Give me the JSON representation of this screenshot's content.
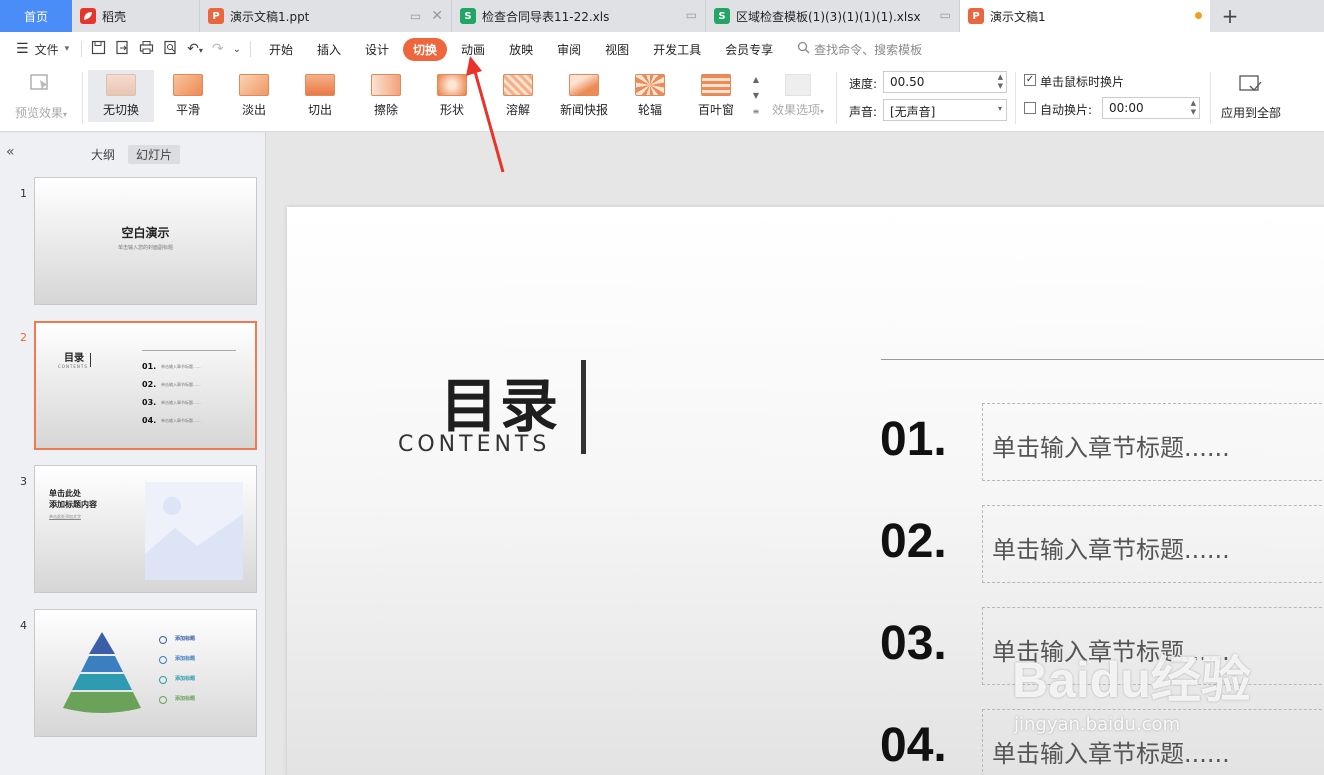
{
  "tabs": [
    {
      "label": "首页"
    },
    {
      "label": "稻壳"
    },
    {
      "label": "演示文稿1.ppt"
    },
    {
      "label": "检查合同导表11-22.xls"
    },
    {
      "label": "区域检查模板(1)(3)(1)(1)(1).xlsx"
    },
    {
      "label": "演示文稿1"
    }
  ],
  "tab_plus": "+",
  "menu": {
    "file": "文件",
    "tabs": [
      "开始",
      "插入",
      "设计",
      "切换",
      "动画",
      "放映",
      "审阅",
      "视图",
      "开发工具",
      "会员专享"
    ],
    "active_tab": "切换",
    "search_placeholder": "查找命令、搜索模板"
  },
  "ribbon": {
    "preview": "预览效果",
    "effects": [
      "无切换",
      "平滑",
      "淡出",
      "切出",
      "擦除",
      "形状",
      "溶解",
      "新闻快报",
      "轮辐",
      "百叶窗"
    ],
    "selected_effect": "无切换",
    "effect_options": "效果选项",
    "speed_label": "速度:",
    "speed_value": "00.50",
    "sound_label": "声音:",
    "sound_value": "[无声音]",
    "click_switch": "单击鼠标时换片",
    "click_switch_checked": true,
    "auto_switch": "自动换片:",
    "auto_switch_checked": false,
    "auto_switch_value": "00:00",
    "apply_all": "应用到全部"
  },
  "left_panel": {
    "collapse": "«",
    "tabs": [
      "大纲",
      "幻灯片"
    ],
    "active_tab": "幻灯片",
    "slides": [
      {
        "num": "1",
        "title": "空白演示",
        "subtitle": "单击输入您的封面副标题"
      },
      {
        "num": "2",
        "title": "目录",
        "subtitle": "CONTENTS",
        "items": [
          "01.",
          "02.",
          "03.",
          "04."
        ],
        "item_text": "单击输入章节标题......"
      },
      {
        "num": "3",
        "title": "单击此处\n添加标题内容",
        "subtitle": "单击此处添加文字"
      },
      {
        "num": "4",
        "labels": [
          "添加标题",
          "添加标题",
          "添加标题",
          "添加标题"
        ]
      }
    ],
    "active_slide": "2"
  },
  "slide": {
    "title": "目录",
    "subtitle": "CONTENTS",
    "items": [
      {
        "num": "01.",
        "text": "单击输入章节标题......"
      },
      {
        "num": "02.",
        "text": "单击输入章节标题......"
      },
      {
        "num": "03.",
        "text": "单击输入章节标题......"
      },
      {
        "num": "04.",
        "text": "单击输入章节标题......"
      }
    ]
  },
  "watermark": {
    "main": "Baidu经验",
    "sub": "jingyan.baidu.com"
  },
  "colors": {
    "accent": "#f0663c",
    "home_tab": "#4a8df8",
    "arrow": "#e8322a"
  }
}
